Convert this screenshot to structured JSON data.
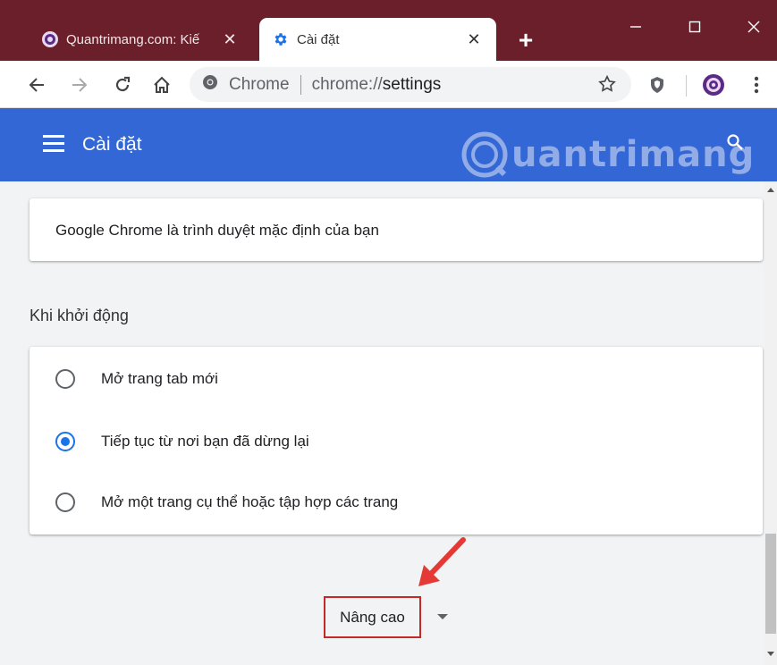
{
  "tabs": [
    {
      "title": "Quantrimang.com: Kiế",
      "active": false,
      "favicon": "quantrimang-logo-icon"
    },
    {
      "title": "Cài đặt",
      "active": true,
      "favicon": "gear-icon"
    }
  ],
  "toolbar": {
    "site_chip": "Chrome",
    "url_scheme": "chrome://",
    "url_path": "settings"
  },
  "header": {
    "title": "Cài đặt",
    "watermark": "uantrimang"
  },
  "default_browser": {
    "text": "Google Chrome là trình duyệt mặc định của bạn"
  },
  "startup": {
    "title": "Khi khởi động",
    "options": [
      {
        "label": "Mở trang tab mới",
        "checked": false
      },
      {
        "label": "Tiếp tục từ nơi bạn đã dừng lại",
        "checked": true
      },
      {
        "label": "Mở một trang cụ thể hoặc tập hợp các trang",
        "checked": false
      }
    ]
  },
  "advanced": {
    "label": "Nâng cao"
  },
  "colors": {
    "titlebar": "#6b1f2a",
    "header": "#3367d6",
    "radio_checked": "#1a73e8",
    "highlight_box": "#c62828",
    "arrow": "#e53935"
  }
}
